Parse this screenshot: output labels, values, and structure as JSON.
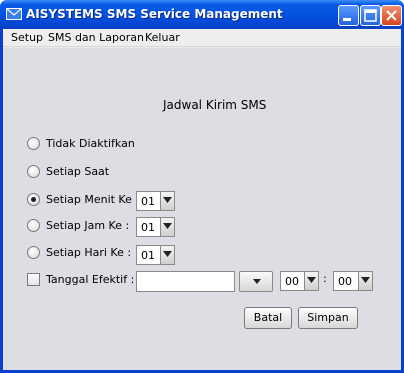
{
  "window": {
    "title": "AISYSTEMS SMS Service Management",
    "title_icon": "mail-icon",
    "controls": {
      "minimize": "minimize-icon",
      "maximize": "maximize-icon",
      "close": "close-icon"
    }
  },
  "menu": {
    "items": [
      "Setup",
      "SMS dan Laporan",
      "Keluar"
    ]
  },
  "form": {
    "heading": "Jadwal Kirim SMS",
    "options": [
      {
        "label": "Tidak Diaktifkan",
        "selected": false
      },
      {
        "label": "Setiap Saat",
        "selected": false
      },
      {
        "label": "Setiap Menit Ke :",
        "selected": true,
        "value": "01"
      },
      {
        "label": "Setiap Jam Ke :",
        "selected": false,
        "value": "01"
      },
      {
        "label": "Setiap Hari Ke :",
        "selected": false,
        "value": "01"
      }
    ],
    "effective_date": {
      "label": "Tanggal Efektif :",
      "checked": false,
      "date_value": "",
      "hour": "00",
      "separator": ":",
      "minute": "00"
    }
  },
  "buttons": {
    "cancel": "Batal",
    "save": "Simpan"
  },
  "colors": {
    "titlebar": "#0552e0",
    "panel": "#dcdee4"
  }
}
